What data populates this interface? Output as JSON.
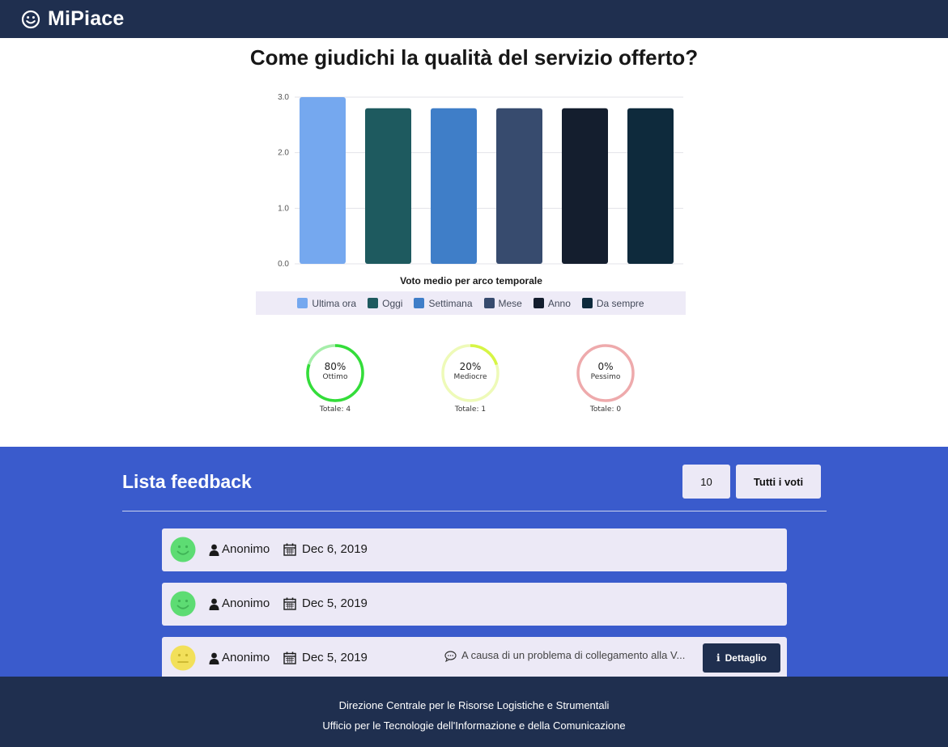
{
  "app": {
    "brand": "MiPiace",
    "brand_icon": "smiley-icon"
  },
  "page": {
    "title": "Come giudichi la qualità del servizio offerto?"
  },
  "chart_data": {
    "type": "bar",
    "categories": [
      "Ultima ora",
      "Oggi",
      "Settimana",
      "Mese",
      "Anno",
      "Da sempre"
    ],
    "values": [
      3.0,
      2.8,
      2.8,
      2.8,
      2.8,
      2.8
    ],
    "colors": [
      "#75a8ef",
      "#1e5a5f",
      "#3f7ec8",
      "#374b6e",
      "#141e2e",
      "#0e2a3c"
    ],
    "xlabel": "Voto medio per arco temporale",
    "ylabel": "",
    "ylim": [
      0,
      3.0
    ],
    "yticks": [
      "0.0",
      "1.0",
      "2.0",
      "3.0"
    ],
    "grid": true,
    "legend_position": "bottom"
  },
  "gauges": [
    {
      "percent": "80%",
      "label": "Ottimo",
      "total": "Totale: 4",
      "value": 0.8,
      "color": "#34dd3a",
      "track": "#a6eeaa"
    },
    {
      "percent": "20%",
      "label": "Mediocre",
      "total": "Totale: 1",
      "value": 0.2,
      "color": "#d6f545",
      "track": "#eefab8"
    },
    {
      "percent": "0%",
      "label": "Pessimo",
      "total": "Totale: 0",
      "value": 0.0,
      "color": "#e05a60",
      "track": "#eeaaac"
    }
  ],
  "feedback": {
    "title": "Lista feedback",
    "count_value": "10",
    "filter_label": "Tutti i voti",
    "detail_label": "Dettaglio",
    "items": [
      {
        "face": "happy-face-icon",
        "face_color": "#5ddc73",
        "user": "Anonimo",
        "date": "Dec 6, 2019",
        "comment": ""
      },
      {
        "face": "happy-face-icon",
        "face_color": "#5ddc73",
        "user": "Anonimo",
        "date": "Dec 5, 2019",
        "comment": ""
      },
      {
        "face": "neutral-face-icon",
        "face_color": "#f2e05a",
        "user": "Anonimo",
        "date": "Dec 5, 2019",
        "comment": "A causa di un problema di collegamento alla V..."
      }
    ]
  },
  "footer": {
    "line1": "Direzione Centrale per le Risorse Logistiche e Strumentali",
    "line2": "Ufficio per le Tecnologie dell'Informazione e della Comunicazione"
  },
  "colors": {
    "navbar": "#1f2f4f",
    "section_blue": "#3a5bcc",
    "row_background": "#ece9f6"
  }
}
